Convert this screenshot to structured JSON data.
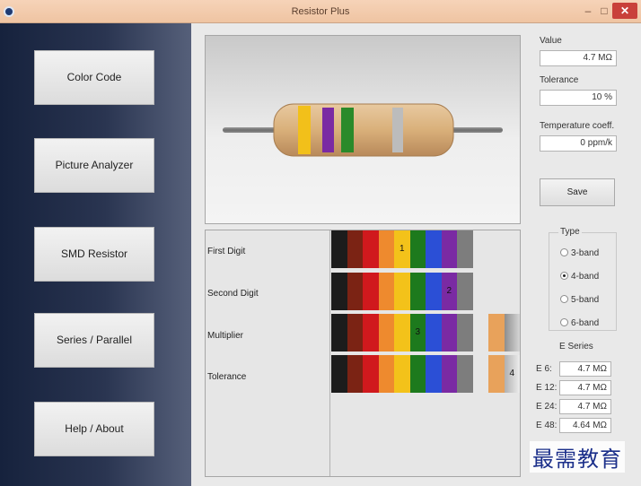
{
  "window": {
    "title": "Resistor Plus",
    "minimize": "–",
    "maximize": "□",
    "close": "✕"
  },
  "sidebar": {
    "items": [
      {
        "label": "Color Code"
      },
      {
        "label": "Picture Analyzer"
      },
      {
        "label": "SMD Resistor"
      },
      {
        "label": "Series / Parallel"
      },
      {
        "label": "Help / About"
      }
    ]
  },
  "resistor": {
    "bands": [
      "#f2c01a",
      "#7a2aa3",
      "#2a8a2a",
      "#bcbcbc"
    ],
    "body_color": "#deb887",
    "lead_color": "#777777"
  },
  "info": {
    "value_label": "Value",
    "value": "4.7 MΩ",
    "tolerance_label": "Tolerance",
    "tolerance": "10 %",
    "temp_label": "Temperature coeff.",
    "temp": "0 ppm/k",
    "save_label": "Save"
  },
  "bands": {
    "rows": [
      {
        "label": "First Digit",
        "selected_marker": "1"
      },
      {
        "label": "Second Digit",
        "selected_marker": "2"
      },
      {
        "label": "Multiplier",
        "selected_marker": "3"
      },
      {
        "label": "Tolerance",
        "selected_marker": "4"
      }
    ],
    "colors": [
      "#1c1c1c",
      "#7b2314",
      "#d0191d",
      "#ee8a2e",
      "#f3c21a",
      "#1d7a1d",
      "#2b4fd6",
      "#7a2aa3",
      "#7d7d7d",
      "#e6e6e6",
      "#e8a25b",
      "#b7b7b7"
    ]
  },
  "type": {
    "title": "Type",
    "options": [
      "3-band",
      "4-band",
      "5-band",
      "6-band"
    ],
    "selected": "4-band"
  },
  "e_series": {
    "title": "E Series",
    "rows": [
      {
        "label": "E 6:",
        "value": "4.7 MΩ"
      },
      {
        "label": "E 12:",
        "value": "4.7 MΩ"
      },
      {
        "label": "E 24:",
        "value": "4.7 MΩ"
      },
      {
        "label": "E 48:",
        "value": "4.64 MΩ"
      }
    ]
  },
  "watermark": "最需教育"
}
